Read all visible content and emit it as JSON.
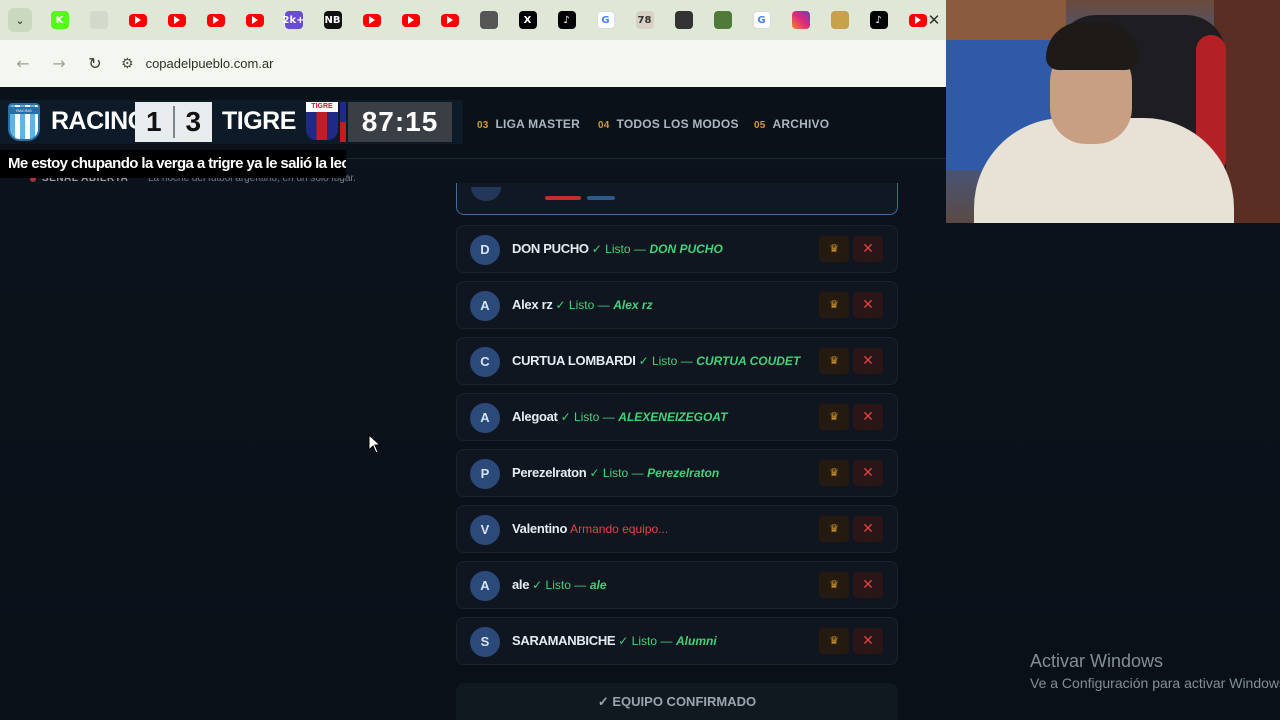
{
  "browser": {
    "tabs": [
      {
        "icon": "tab-list-icon",
        "label": ""
      },
      {
        "icon": "kick-icon",
        "label": "K",
        "color": "#53fc18"
      },
      {
        "icon": "generic-tab-icon",
        "label": "",
        "color": "#c9d2c3"
      },
      {
        "icon": "youtube-icon",
        "label": "",
        "color": "#ff0000"
      },
      {
        "icon": "youtube-icon",
        "label": "",
        "color": "#ff0000"
      },
      {
        "icon": "youtube-icon",
        "label": "",
        "color": "#ff0000"
      },
      {
        "icon": "youtube-icon",
        "label": "",
        "color": "#ff0000"
      },
      {
        "icon": "2kplus-icon",
        "label": "2k+",
        "color": "#6a4bd6"
      },
      {
        "icon": "news-icon",
        "label": "NB",
        "color": "#111111"
      },
      {
        "icon": "youtube-icon",
        "label": "",
        "color": "#ff0000"
      },
      {
        "icon": "youtube-icon",
        "label": "",
        "color": "#ff0000"
      },
      {
        "icon": "youtube-icon",
        "label": "",
        "color": "#ff0000"
      },
      {
        "icon": "chrome-icon",
        "label": "",
        "color": "#555555"
      },
      {
        "icon": "x-icon",
        "label": "X",
        "color": "#000000"
      },
      {
        "icon": "tiktok-icon",
        "label": "♪",
        "color": "#000000"
      },
      {
        "icon": "google-icon",
        "label": "G",
        "color": "#ffffff"
      },
      {
        "icon": "tab-78-icon",
        "label": "78",
        "color": "#d9d2c4"
      },
      {
        "icon": "discord-like-icon",
        "label": "",
        "color": "#333333"
      },
      {
        "icon": "avatar-tab-icon",
        "label": "",
        "color": "#4f7a3a"
      },
      {
        "icon": "google-icon",
        "label": "G",
        "color": "#ffffff"
      },
      {
        "icon": "instagram-icon",
        "label": "",
        "color": "#d6249f"
      },
      {
        "icon": "food-tab-icon",
        "label": "",
        "color": "#c8a24a"
      },
      {
        "icon": "tiktok-icon",
        "label": "♪",
        "color": "#000000"
      },
      {
        "icon": "youtube-icon",
        "label": "",
        "color": "#ff0000"
      }
    ],
    "close_glyph": "✕",
    "url": "copadelpueblo.com.ar"
  },
  "site_nav": {
    "items": [
      {
        "num": "03",
        "label": "LIGA MASTER"
      },
      {
        "num": "04",
        "label": "TODOS LOS MODOS"
      },
      {
        "num": "05",
        "label": "ARCHIVO"
      }
    ],
    "live_tag": "SEÑAL ABIERTA",
    "live_desc": "La noche del fútbol argentino, en un solo lugar."
  },
  "scoreboard": {
    "home_team": "RACING",
    "home_score": "1",
    "away_score": "3",
    "away_team": "TIGRE",
    "home_crest_text": "RACING",
    "away_crest_text": "TIGRE",
    "clock": "87:15",
    "ticker": "Me estoy chupando la verga a trigre ya le salió la leche soy Racing la putita"
  },
  "players": [
    {
      "initial": "D",
      "name": "DON PUCHO",
      "status": "✓ Listo —",
      "team": "DON PUCHO",
      "state": "ready"
    },
    {
      "initial": "A",
      "name": "Alex rz",
      "status": "✓ Listo —",
      "team": "Alex rz",
      "state": "ready"
    },
    {
      "initial": "C",
      "name": "CURTUA LOMBARDI",
      "status": "✓ Listo —",
      "team": "CURTUA COUDET",
      "state": "ready"
    },
    {
      "initial": "A",
      "name": "Alegoat",
      "status": "✓ Listo —",
      "team": "ALEXENEIZEGOAT",
      "state": "ready"
    },
    {
      "initial": "P",
      "name": "Perezelraton",
      "status": "✓ Listo —",
      "team": "Perezelraton",
      "state": "ready"
    },
    {
      "initial": "V",
      "name": "Valentino",
      "status": "Armando equipo...",
      "team": "",
      "state": "building"
    },
    {
      "initial": "A",
      "name": "ale",
      "status": "✓ Listo —",
      "team": "ale",
      "state": "ready"
    },
    {
      "initial": "S",
      "name": "SARAMANBICHE",
      "status": "✓ Listo —",
      "team": "Alumni",
      "state": "ready"
    }
  ],
  "row_actions": {
    "crown": "♛",
    "remove": "✕"
  },
  "confirm_label": "✓ EQUIPO CONFIRMADO",
  "watermark": {
    "title": "Activar Windows",
    "subtitle": "Ve a Configuración para activar Windows."
  },
  "colors": {
    "ready": "#3fd37a",
    "building": "#e04444",
    "accent": "#d29a2a"
  }
}
